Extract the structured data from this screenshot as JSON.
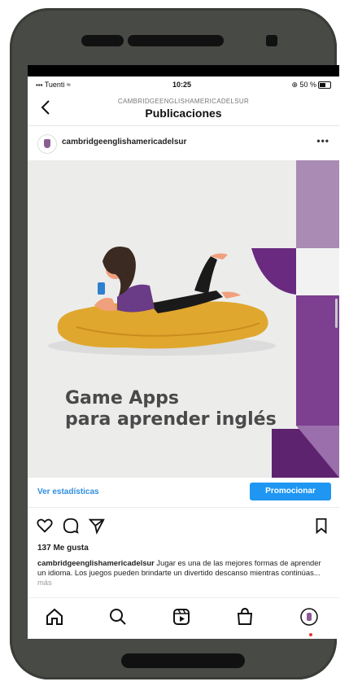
{
  "status_bar": {
    "carrier": "Tuenti",
    "time": "10:25",
    "battery": "50 %"
  },
  "header": {
    "account": "CAMBRIDGEENGLISHAMERICADELSUR",
    "title": "Publicaciones"
  },
  "post": {
    "username": "cambridgeenglishamericadelsur",
    "more_icon": "more-horizontal-icon",
    "image_text_line1": "Game Apps",
    "image_text_line2": "para aprender inglés",
    "stats_link": "Ver estadísticas",
    "promote_button": "Promocionar",
    "likes": "137 Me gusta",
    "caption_user": "cambridgeenglishamericadelsur",
    "caption_text": " Jugar es una de las mejores formas de aprender un idioma. Los juegos pueden brindarte un divertido descanso mientras continúas...",
    "caption_more": " más"
  },
  "colors": {
    "accent_blue": "#1e96f2",
    "link_blue": "#2f8ee0",
    "purple": "#7b3f8f",
    "phone_body": "#484a46"
  },
  "nav": {
    "items": [
      "home-icon",
      "search-icon",
      "reels-icon",
      "shop-icon",
      "profile-icon"
    ]
  }
}
